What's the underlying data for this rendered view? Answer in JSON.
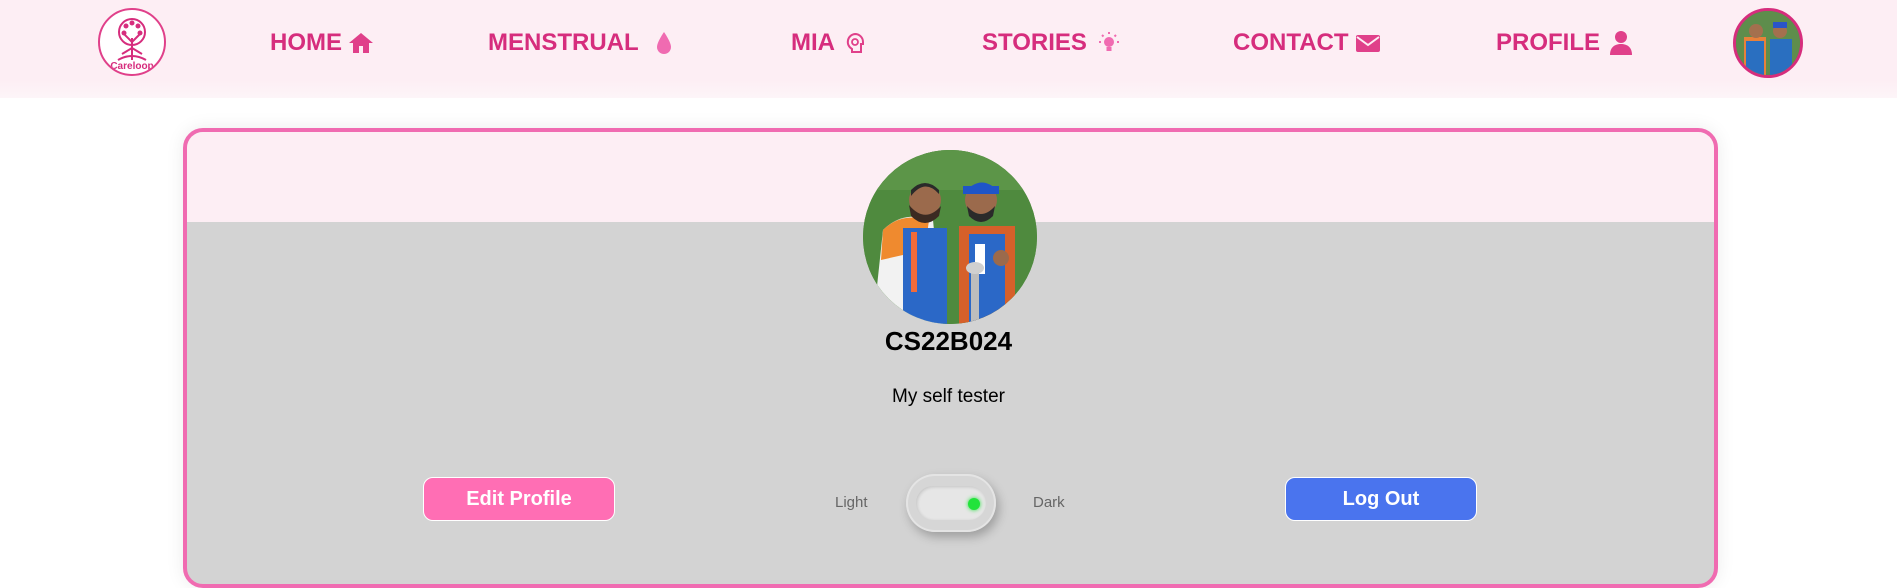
{
  "nav": {
    "logo_text": "Careloop",
    "items": [
      {
        "label": "HOME",
        "icon": "home-icon"
      },
      {
        "label": "MENSTRUAL",
        "icon": "drop-icon"
      },
      {
        "label": "MIA",
        "icon": "head-brain-icon"
      },
      {
        "label": "STORIES",
        "icon": "lightbulb-icon"
      },
      {
        "label": "CONTACT",
        "icon": "envelope-icon"
      },
      {
        "label": "PROFILE",
        "icon": "user-icon"
      }
    ],
    "avatar": "user-avatar"
  },
  "profile": {
    "username": "CS22B024",
    "bio": "My self tester",
    "edit_label": "Edit Profile",
    "logout_label": "Log Out",
    "theme_light_label": "Light",
    "theme_dark_label": "Dark"
  },
  "colors": {
    "nav_text": "#d62d7d",
    "nav_bg": "#fdeef4",
    "card_border": "#f06bb1",
    "card_bg": "#d3d3d3",
    "edit_button": "#ff6eb4",
    "logout_button": "#4a74ee",
    "toggle_dot": "#22e33b"
  }
}
